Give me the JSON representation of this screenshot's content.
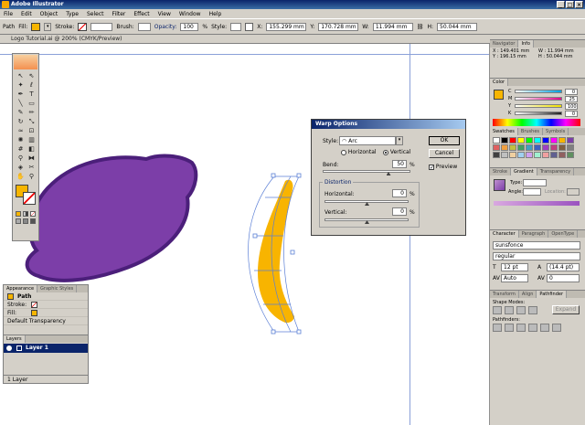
{
  "window": {
    "title": "Adobe Illustrator",
    "buttons": [
      "_",
      "□",
      "×"
    ]
  },
  "menu": {
    "items": [
      "File",
      "Edit",
      "Object",
      "Type",
      "Select",
      "Filter",
      "Effect",
      "View",
      "Window",
      "Help"
    ]
  },
  "control_bar": {
    "object_type": "Path",
    "fill_label": "Fill:",
    "stroke_label": "Stroke:",
    "brush_label": "Brush:",
    "opacity_label": "Opacity:",
    "opacity_value": "100",
    "opacity_unit": "%",
    "style_label": "Style:",
    "x_label": "X:",
    "x_value": "155.299 mm",
    "y_label": "Y:",
    "y_value": "170.728 mm",
    "w_label": "W:",
    "w_value": "11.994 mm",
    "h_label": "H:",
    "h_value": "50.044 mm",
    "fill_color": "#f7b500"
  },
  "document": {
    "tab_title": "Logo Tutorial.ai @ 200% (CMYK/Preview)"
  },
  "canvas": {
    "purple_color": "#7c3ea8",
    "purple_outline": "#4b1f7a",
    "orange_color": "#f8b400",
    "selection_color": "#5b7fd6"
  },
  "warp_dialog": {
    "title": "Warp Options",
    "style_label": "Style:",
    "style_value": "Arc",
    "horizontal_label": "Horizontal",
    "vertical_label": "Vertical",
    "selected_orientation": "Vertical",
    "bend_label": "Bend:",
    "bend_value": "50",
    "percent": "%",
    "distortion_label": "Distortion",
    "horizontal_dist_label": "Horizontal:",
    "horizontal_dist_value": "0",
    "vertical_dist_label": "Vertical:",
    "vertical_dist_value": "0",
    "ok_label": "OK",
    "cancel_label": "Cancel",
    "preview_label": "Preview",
    "preview_checked": true,
    "bend_level": 0.75
  },
  "appearance_panel": {
    "tabs": [
      "Appearance",
      "Graphic Styles"
    ],
    "object": "Path",
    "stroke_label": "Stroke:",
    "fill_label": "Fill:",
    "transparency": "Default Transparency"
  },
  "layers_panel": {
    "tab": "Layers",
    "layer_name": "Layer 1",
    "footer": "1 Layer"
  },
  "right_panels": {
    "navigator_tabs": [
      "Navigator",
      "Info"
    ],
    "info": {
      "x_label": "X :",
      "x_value": "149.401 mm",
      "y_label": "Y :",
      "y_value": "196.15 mm",
      "w_label": "W :",
      "w_value": "11.994 mm",
      "h_label": "H :",
      "h_value": "50.044 mm"
    },
    "color_tab": "Color",
    "color_values": [
      {
        "label": "C",
        "value": "0",
        "color": "#00a0e0"
      },
      {
        "label": "M",
        "value": "25",
        "color": "#e0008a"
      },
      {
        "label": "Y",
        "value": "100",
        "color": "#f0e000"
      },
      {
        "label": "K",
        "value": "0",
        "color": "#202020"
      }
    ],
    "swatches_tabs": [
      "Swatches",
      "Brushes",
      "Symbols"
    ],
    "stroke_tabs": [
      "Stroke",
      "Gradient",
      "Transparency"
    ],
    "gradient_type_label": "Type:",
    "gradient_angle_label": "Angle:",
    "gradient_location_label": "Location:",
    "character_tabs": [
      "Character",
      "Paragraph",
      "OpenType"
    ],
    "font_name": "sunsfonce",
    "font_style": "regular",
    "font_size": "12 pt",
    "leading": "(14.4 pt)",
    "kerning": "Auto",
    "tracking": "0",
    "pathfinder_tabs": [
      "Transform",
      "Align",
      "Pathfinder"
    ],
    "shape_modes_label": "Shape Modes:",
    "expand_label": "Expand",
    "pathfinders_label": "Pathfinders:"
  }
}
